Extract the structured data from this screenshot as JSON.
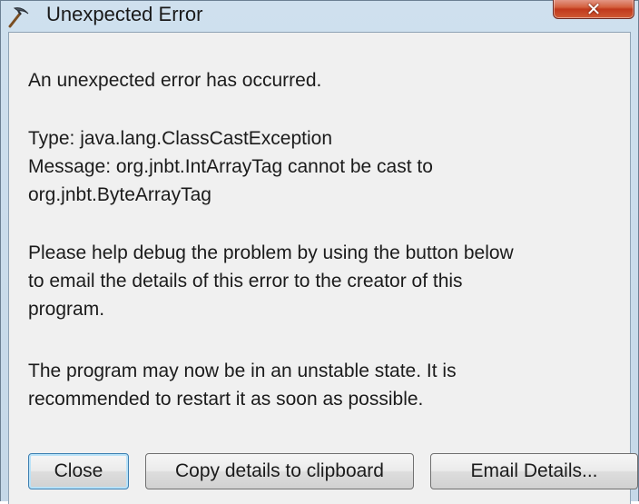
{
  "window": {
    "title": "Unexpected Error",
    "icon": "pickaxe-icon",
    "close_glyph": "✕",
    "colors": {
      "frame": "#c5d8e8",
      "content_bg": "#f0f0f0",
      "close_button": "#c1391c",
      "default_button_border": "#3c7fb1"
    }
  },
  "message": {
    "intro": "An unexpected error has occurred.",
    "type_line": "Type: java.lang.ClassCastException",
    "message_line_1": "Message: org.jnbt.IntArrayTag cannot be cast to",
    "message_line_2": "org.jnbt.ByteArrayTag",
    "help_line_1": "Please help debug the problem by using the button below",
    "help_line_2": "to email the details of this error to the creator of this",
    "help_line_3": "program.",
    "warning_line_1": "The program may now be in an unstable state. It is",
    "warning_line_2": "recommended to restart it as soon as possible."
  },
  "buttons": {
    "close": "Close",
    "copy": "Copy details to clipboard",
    "email": "Email Details..."
  }
}
